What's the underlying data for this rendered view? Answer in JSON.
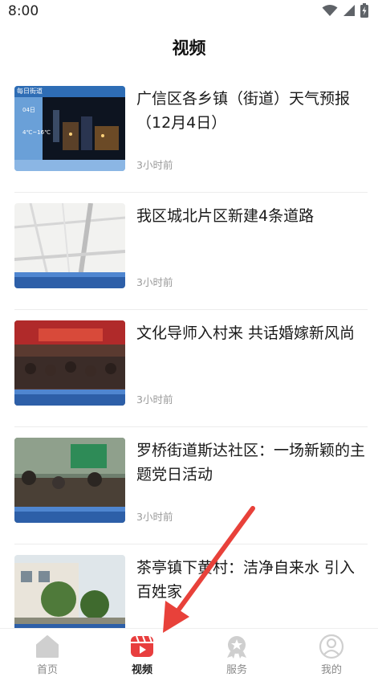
{
  "status": {
    "time": "8:00"
  },
  "header": {
    "title": "视频"
  },
  "feed": {
    "items": [
      {
        "title": "广信区各乡镇（街道）天气预报（12月4日）",
        "time": "3小时前",
        "thumb_caption": "每日街道"
      },
      {
        "title": "我区城北片区新建4条道路",
        "time": "3小时前"
      },
      {
        "title": "文化导师入村来 共话婚嫁新风尚",
        "time": "3小时前"
      },
      {
        "title": "罗桥街道斯达社区：一场新颖的主题党日活动",
        "time": "3小时前"
      },
      {
        "title": "茶亭镇下黄村：洁净自来水 引入百姓家",
        "time": ""
      }
    ]
  },
  "tabbar": {
    "tabs": [
      {
        "label": "首页",
        "icon": "home-icon"
      },
      {
        "label": "视频",
        "icon": "video-icon",
        "active": true
      },
      {
        "label": "服务",
        "icon": "service-icon"
      },
      {
        "label": "我的",
        "icon": "profile-icon"
      }
    ]
  },
  "colors": {
    "accent": "#e83e3e",
    "annotation_arrow": "#e8413a",
    "inactive_icon": "#cfcfcf"
  }
}
